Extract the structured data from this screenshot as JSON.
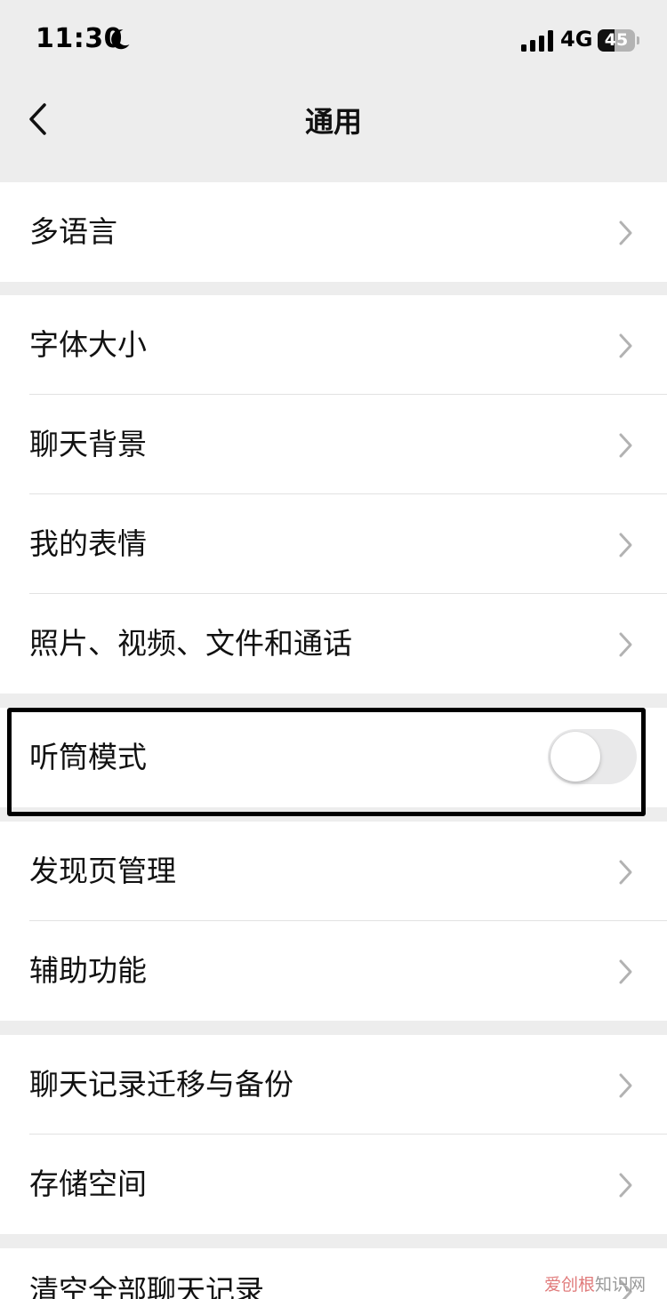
{
  "status_bar": {
    "time": "11:30",
    "network": "4G",
    "battery_level": "45",
    "battery_fraction": 0.45,
    "icons": [
      "moon-icon",
      "signal-icon",
      "battery-icon"
    ]
  },
  "nav": {
    "title": "通用",
    "back_icon": "chevron-left-icon"
  },
  "groups": [
    {
      "items": [
        {
          "label": "多语言",
          "type": "link"
        }
      ]
    },
    {
      "items": [
        {
          "label": "字体大小",
          "type": "link"
        },
        {
          "label": "聊天背景",
          "type": "link"
        },
        {
          "label": "我的表情",
          "type": "link"
        },
        {
          "label": "照片、视频、文件和通话",
          "type": "link"
        }
      ]
    },
    {
      "items": [
        {
          "label": "听筒模式",
          "type": "toggle",
          "value": false
        }
      ]
    },
    {
      "items": [
        {
          "label": "发现页管理",
          "type": "link"
        },
        {
          "label": "辅助功能",
          "type": "link"
        }
      ]
    },
    {
      "items": [
        {
          "label": "聊天记录迁移与备份",
          "type": "link"
        },
        {
          "label": "存储空间",
          "type": "link"
        }
      ]
    },
    {
      "items": [
        {
          "label": "清空全部聊天记录",
          "type": "link"
        }
      ]
    }
  ],
  "watermark": {
    "accent": "爱创根",
    "rest": "知识网"
  },
  "colors": {
    "background": "#ededed",
    "card": "#ffffff",
    "text": "#111111",
    "chevron": "#b2b2b2",
    "toggle_off": "#e9e9ea",
    "highlight": "#000000"
  }
}
